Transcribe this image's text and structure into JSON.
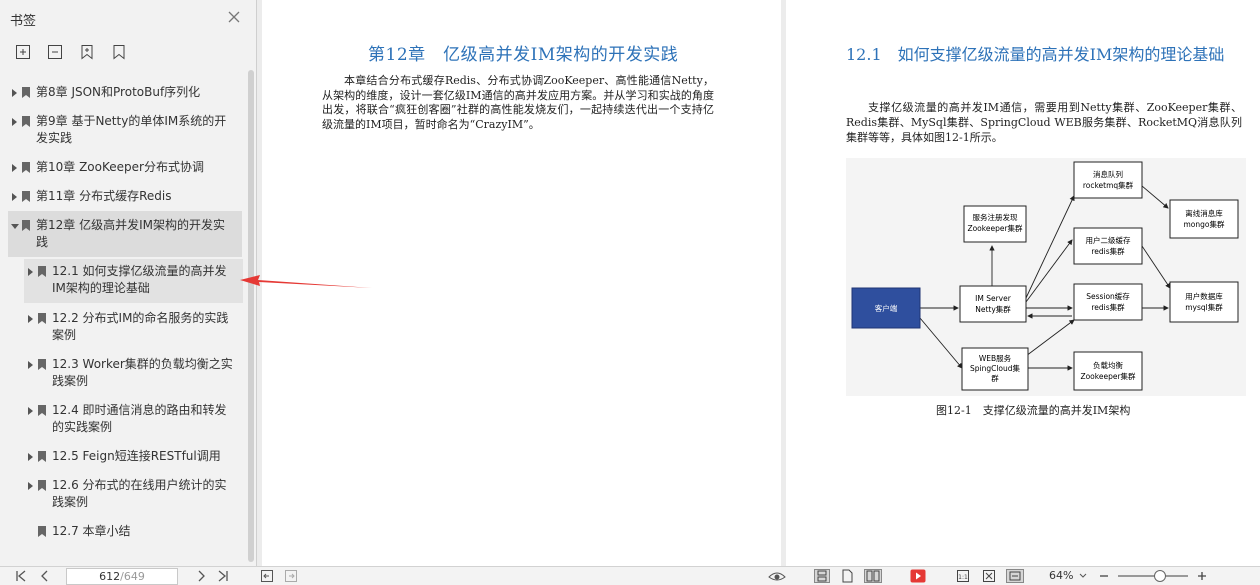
{
  "sidebar": {
    "title": "书签",
    "tools": [
      "expand-all-icon",
      "collapse-all-icon",
      "add-bookmark-icon",
      "bookmark-icon"
    ],
    "items": [
      {
        "label": "第8章 JSON和ProtoBuf序列化",
        "level": 0
      },
      {
        "label": "第9章 基于Netty的单体IM系统的开发实践",
        "level": 0
      },
      {
        "label": "第10章 ZooKeeper分布式协调",
        "level": 0
      },
      {
        "label": "第11章 分布式缓存Redis",
        "level": 0
      },
      {
        "label": "第12章 亿级高并发IM架构的开发实践",
        "level": 0
      },
      {
        "label": "12.1 如何支撑亿级流量的高并发IM架构的理论基础",
        "level": 1
      },
      {
        "label": "12.2 分布式IM的命名服务的实践案例",
        "level": 1
      },
      {
        "label": "12.3 Worker集群的负载均衡之实践案例",
        "level": 1
      },
      {
        "label": "12.4 即时通信消息的路由和转发的实践案例",
        "level": 1
      },
      {
        "label": "12.5 Feign短连接RESTful调用",
        "level": 1
      },
      {
        "label": "12.6 分布式的在线用户统计的实践案例",
        "level": 1
      },
      {
        "label": "12.7 本章小结",
        "level": 1
      }
    ]
  },
  "left_page": {
    "title": "第12章　亿级高并发IM架构的开发实践",
    "body": "本章结合分布式缓存Redis、分布式协调ZooKeeper、高性能通信Netty，从架构的维度，设计一套亿级IM通信的高并发应用方案。并从学习和实战的角度出发，将联合“疯狂创客圈”社群的高性能发烧友们，一起持续迭代出一个支持亿级流量的IM项目，暂时命名为“CrazyIM”。"
  },
  "right_page": {
    "title": "12.1　如何支撑亿级流量的高并发IM架构的理论基础",
    "body": "支撑亿级流量的高并发IM通信，需要用到Netty集群、ZooKeeper集群、Redis集群、MySql集群、SpringCloud WEB服务集群、RocketMQ消息队列集群等等，具体如图12-1所示。",
    "figure_caption": "图12-1　支撑亿级流量的高并发IM架构",
    "diagram": {
      "client": "客户端",
      "zk_naming": [
        "服务注册发现",
        "Zookeeper集群"
      ],
      "mq": [
        "消息队列",
        "rocketmq集群"
      ],
      "offline_db": [
        "离线消息库",
        "mongo集群"
      ],
      "user_cache": [
        "用户二级缓存",
        "redis集群"
      ],
      "im_server": [
        "IM Server",
        "Netty集群"
      ],
      "session_cache": [
        "Session缓存",
        "redis集群"
      ],
      "user_db": [
        "用户数据库",
        "mysql集群"
      ],
      "web": [
        "WEB服务",
        "SpingCloud集",
        "群"
      ],
      "lb": [
        "负载均衡",
        "Zookeeper集群"
      ],
      "client_color": "#2f4f9e"
    }
  },
  "toolbar": {
    "page_current": "612",
    "page_total": "/649",
    "zoom": "64%",
    "zoom_level": 0.6
  },
  "colors": {
    "accent": "#2d72b8",
    "arrow": "#e53935"
  }
}
